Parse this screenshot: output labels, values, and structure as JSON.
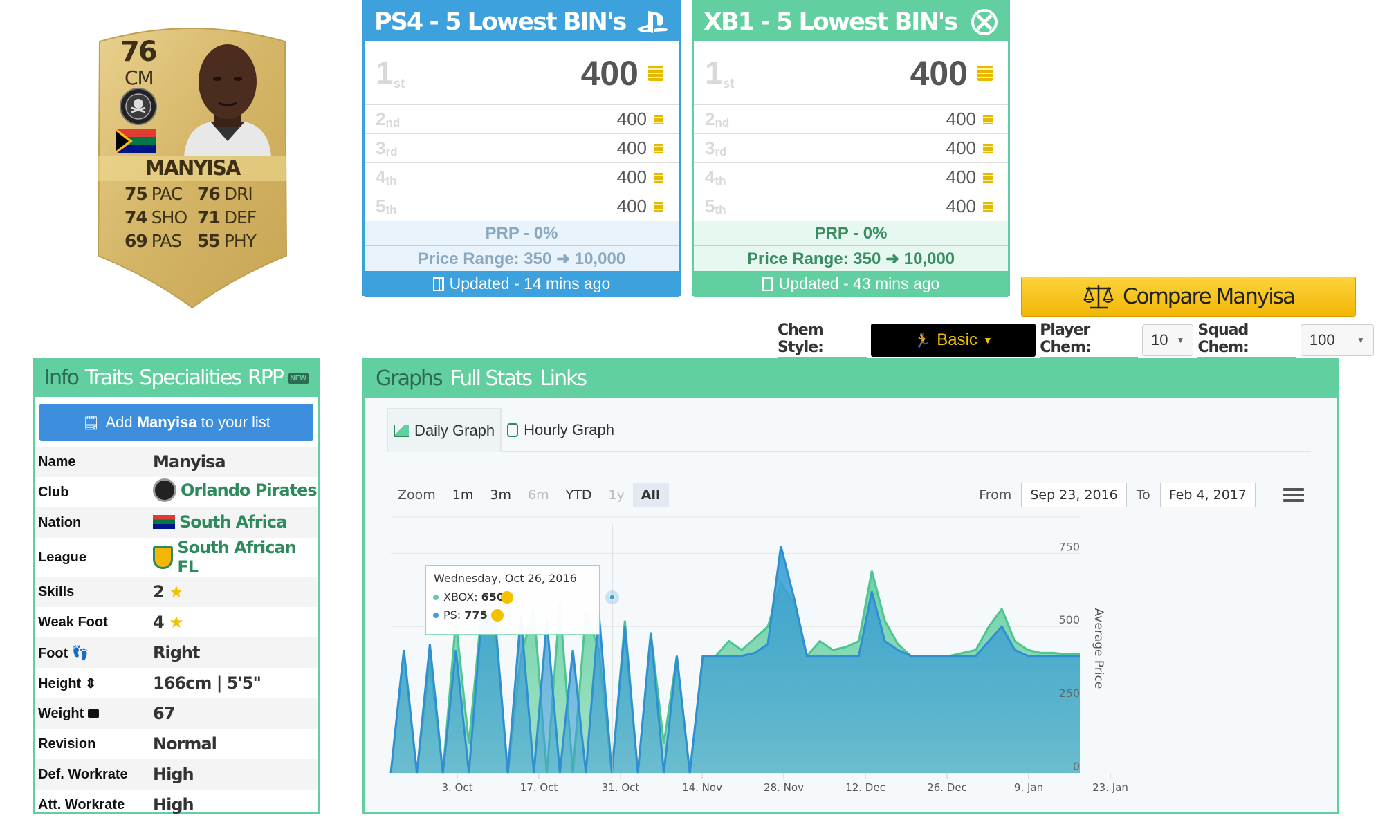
{
  "card": {
    "rating": "76",
    "position": "CM",
    "name": "MANYISA",
    "stats": [
      {
        "value": "75",
        "label": "PAC"
      },
      {
        "value": "76",
        "label": "DRI"
      },
      {
        "value": "74",
        "label": "SHO"
      },
      {
        "value": "71",
        "label": "DEF"
      },
      {
        "value": "69",
        "label": "PAS"
      },
      {
        "value": "55",
        "label": "PHY"
      }
    ]
  },
  "ps4": {
    "title": "PS4 - 5 Lowest BIN's",
    "prices": [
      {
        "ord": "1",
        "suf": "st",
        "value": "400"
      },
      {
        "ord": "2",
        "suf": "nd",
        "value": "400"
      },
      {
        "ord": "3",
        "suf": "rd",
        "value": "400"
      },
      {
        "ord": "4",
        "suf": "th",
        "value": "400"
      },
      {
        "ord": "5",
        "suf": "th",
        "value": "400"
      }
    ],
    "prp": "PRP - 0%",
    "range": "Price Range: 350 ➜ 10,000",
    "updated": "Updated - 14 mins ago"
  },
  "xb1": {
    "title": "XB1 - 5 Lowest BIN's",
    "prices": [
      {
        "ord": "1",
        "suf": "st",
        "value": "400"
      },
      {
        "ord": "2",
        "suf": "nd",
        "value": "400"
      },
      {
        "ord": "3",
        "suf": "rd",
        "value": "400"
      },
      {
        "ord": "4",
        "suf": "th",
        "value": "400"
      },
      {
        "ord": "5",
        "suf": "th",
        "value": "400"
      }
    ],
    "prp": "PRP - 0%",
    "range": "Price Range: 350 ➜ 10,000",
    "updated": "Updated - 43 mins ago"
  },
  "compare_label": "Compare Manyisa",
  "chem": {
    "style_label": "Chem Style:",
    "style_value": "Basic",
    "player_label": "Player Chem:",
    "player_value": "10",
    "squad_label": "Squad Chem:",
    "squad_value": "100"
  },
  "info": {
    "tabs": [
      "Info",
      "Traits",
      "Specialities",
      "RPP"
    ],
    "new_tag": "NEW",
    "add_prefix": "Add ",
    "add_name": "Manyisa",
    "add_suffix": " to your list",
    "rows": [
      {
        "k": "Name",
        "v": "Manyisa"
      },
      {
        "k": "Club",
        "v": "Orlando Pirates"
      },
      {
        "k": "Nation",
        "v": "South Africa"
      },
      {
        "k": "League",
        "v": "South African FL"
      },
      {
        "k": "Skills",
        "v": "2"
      },
      {
        "k": "Weak Foot",
        "v": "4"
      },
      {
        "k": "Foot",
        "v": "Right"
      },
      {
        "k": "Height",
        "v": "166cm | 5'5\""
      },
      {
        "k": "Weight",
        "v": "67"
      },
      {
        "k": "Revision",
        "v": "Normal"
      },
      {
        "k": "Def. Workrate",
        "v": "High"
      },
      {
        "k": "Att. Workrate",
        "v": "High"
      }
    ]
  },
  "graph": {
    "tabs": [
      "Graphs",
      "Full Stats",
      "Links"
    ],
    "subtabs": [
      "Daily Graph",
      "Hourly Graph"
    ],
    "zoom_label": "Zoom",
    "zoom": [
      "1m",
      "3m",
      "6m",
      "YTD",
      "1y",
      "All"
    ],
    "from_label": "From",
    "from": "Sep 23, 2016",
    "to_label": "To",
    "to": "Feb 4, 2017",
    "tooltip": {
      "date": "Wednesday, Oct 26, 2016",
      "xbox_label": "XBOX:",
      "xbox": "650",
      "ps_label": "PS:",
      "ps": "775"
    }
  },
  "chart_data": {
    "type": "area",
    "ylabel": "Average Price",
    "ylim": [
      0,
      850
    ],
    "yticks": [
      0,
      250,
      500,
      750
    ],
    "xticks": [
      "3. Oct",
      "17. Oct",
      "31. Oct",
      "14. Nov",
      "28. Nov",
      "12. Dec",
      "26. Dec",
      "9. Jan",
      "23. Jan"
    ],
    "x": [
      "Sep 23",
      "Sep 24",
      "Sep 25",
      "Sep 26",
      "Sep 27",
      "Sep 28",
      "Sep 29",
      "Sep 30",
      "Oct 1",
      "Oct 2",
      "Oct 3",
      "Oct 4",
      "Oct 5",
      "Oct 6",
      "Oct 7",
      "Oct 8",
      "Oct 9",
      "Oct 10",
      "Oct 11",
      "Oct 12",
      "Oct 13",
      "Oct 14",
      "Oct 15",
      "Oct 16",
      "Oct 17",
      "Oct 18",
      "Oct 20",
      "Oct 22",
      "Oct 24",
      "Oct 25",
      "Oct 26",
      "Oct 27",
      "Oct 28",
      "Oct 29",
      "Nov 2",
      "Nov 8",
      "Nov 14",
      "Nov 20",
      "Nov 24",
      "Nov 26",
      "Nov 27",
      "Nov 29",
      "Dec 1",
      "Dec 4",
      "Dec 12",
      "Dec 20",
      "Dec 23",
      "Dec 26",
      "Dec 28",
      "Dec 31",
      "Jan 4",
      "Jan 12",
      "Jan 22",
      "Feb 4"
    ],
    "series": [
      {
        "name": "XBOX",
        "color": "#61cf9f",
        "values": [
          0,
          420,
          0,
          380,
          0,
          520,
          100,
          560,
          520,
          0,
          400,
          560,
          0,
          580,
          0,
          550,
          420,
          0,
          520,
          0,
          480,
          100,
          400,
          0,
          400,
          400,
          450,
          420,
          460,
          500,
          650,
          580,
          400,
          450,
          420,
          430,
          450,
          690,
          520,
          440,
          400,
          400,
          400,
          400,
          410,
          420,
          500,
          560,
          450,
          420,
          410,
          410,
          405,
          405
        ]
      },
      {
        "name": "PS",
        "color": "#3d9fd4",
        "values": [
          0,
          420,
          0,
          440,
          0,
          420,
          0,
          540,
          540,
          0,
          540,
          0,
          520,
          0,
          420,
          0,
          550,
          0,
          500,
          0,
          480,
          0,
          400,
          0,
          400,
          400,
          400,
          400,
          410,
          440,
          775,
          600,
          400,
          400,
          400,
          400,
          400,
          620,
          450,
          420,
          400,
          400,
          400,
          400,
          400,
          400,
          450,
          500,
          420,
          400,
          400,
          400,
          400,
          400
        ]
      }
    ]
  }
}
